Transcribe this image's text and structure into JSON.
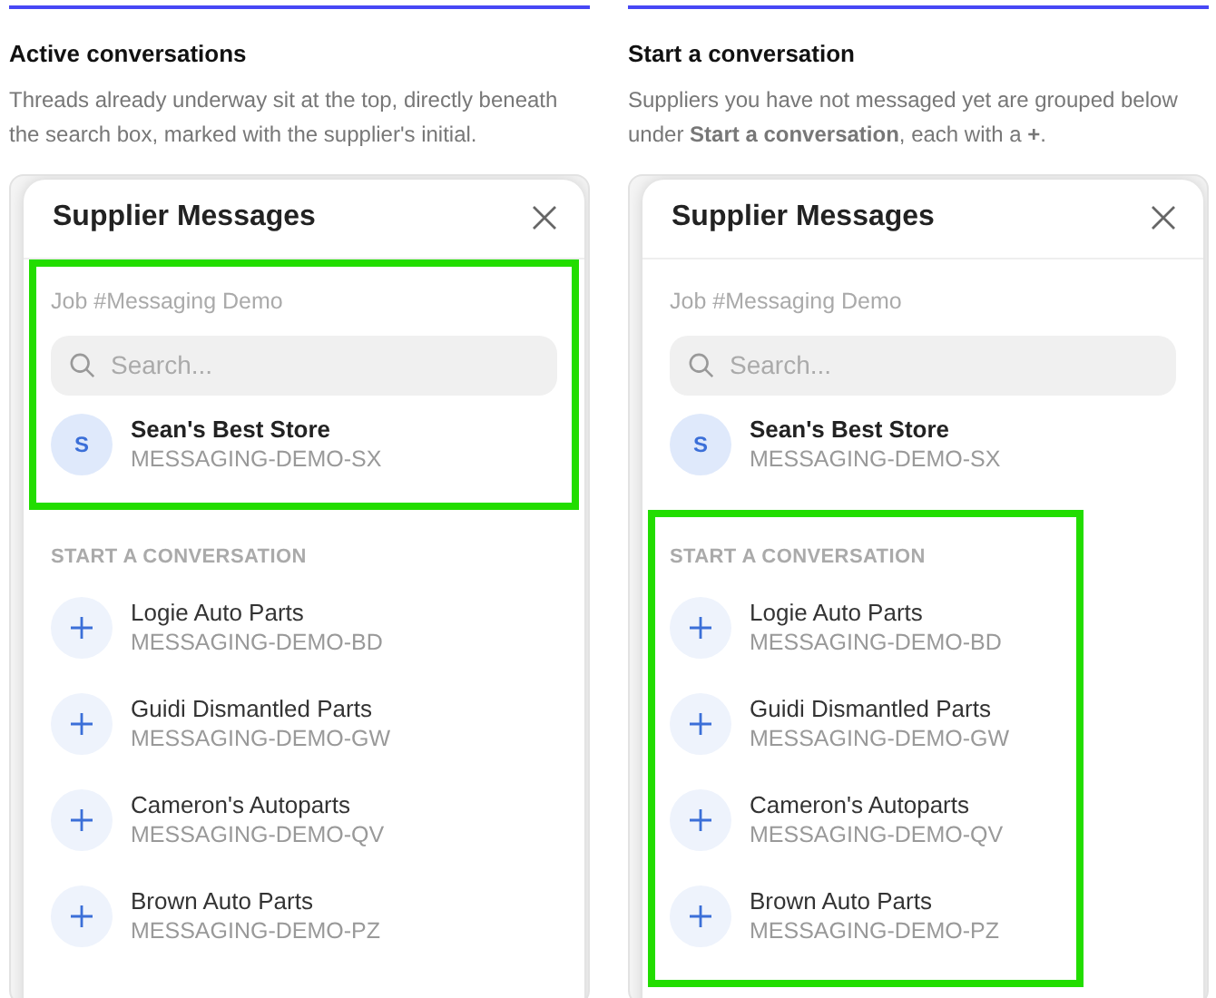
{
  "panels": [
    {
      "title": "Active conversations",
      "description": "Threads already underway sit at the top, directly beneath the search box, marked with the supplier's initial.",
      "threads_highlighted": true,
      "suppliers_highlighted": false,
      "dialog": {
        "title": "Supplier Messages",
        "job": "Job #Messaging Demo",
        "search": {
          "placeholder": "Search..."
        },
        "threads": [
          {
            "initial": "S",
            "name": "Sean's Best Store",
            "code": "MESSAGING-DEMO-SX"
          }
        ],
        "section_label": "START A CONVERSATION",
        "suppliers": [
          {
            "name": "Logie Auto Parts",
            "code": "MESSAGING-DEMO-BD"
          },
          {
            "name": "Guidi Dismantled Parts",
            "code": "MESSAGING-DEMO-GW"
          },
          {
            "name": "Cameron's Autoparts",
            "code": "MESSAGING-DEMO-QV"
          },
          {
            "name": "Brown Auto Parts",
            "code": "MESSAGING-DEMO-PZ"
          }
        ]
      }
    },
    {
      "title": "Start a conversation",
      "description": "Suppliers you have not messaged yet are grouped below under **Start a conversation**, each with a **+**.",
      "threads_highlighted": false,
      "suppliers_highlighted": true,
      "dialog": {
        "title": "Supplier Messages",
        "job": "Job #Messaging Demo",
        "search": {
          "placeholder": "Search..."
        },
        "threads": [
          {
            "initial": "S",
            "name": "Sean's Best Store",
            "code": "MESSAGING-DEMO-SX"
          }
        ],
        "section_label": "START A CONVERSATION",
        "suppliers": [
          {
            "name": "Logie Auto Parts",
            "code": "MESSAGING-DEMO-BD"
          },
          {
            "name": "Guidi Dismantled Parts",
            "code": "MESSAGING-DEMO-GW"
          },
          {
            "name": "Cameron's Autoparts",
            "code": "MESSAGING-DEMO-QV"
          },
          {
            "name": "Brown Auto Parts",
            "code": "MESSAGING-DEMO-PZ"
          }
        ]
      }
    }
  ]
}
